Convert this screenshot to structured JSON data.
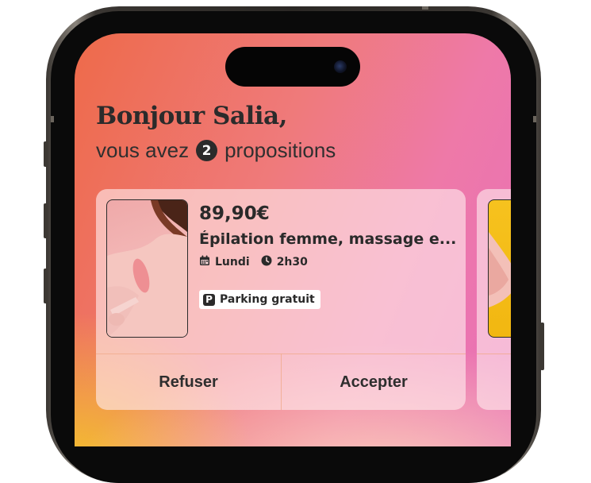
{
  "greeting": "Bonjour Salia,",
  "subtitle": {
    "before": "vous avez",
    "count": "2",
    "after": "propositions"
  },
  "proposal": {
    "price": "89,90€",
    "service": "Épilation femme, massage e...",
    "day": "Lundi",
    "duration": "2h30",
    "parking_icon": "P",
    "parking_label": "Parking gratuit",
    "refuse_label": "Refuser",
    "accept_label": "Accepter"
  },
  "icons": {
    "calendar": "calendar-icon",
    "clock": "clock-icon",
    "parking": "parking-icon"
  },
  "colors": {
    "text_dark": "#2a2a2a",
    "gradient_start": "#ee6a4a",
    "gradient_end": "#e86fb8",
    "gradient_bottom": "#f4c428"
  }
}
